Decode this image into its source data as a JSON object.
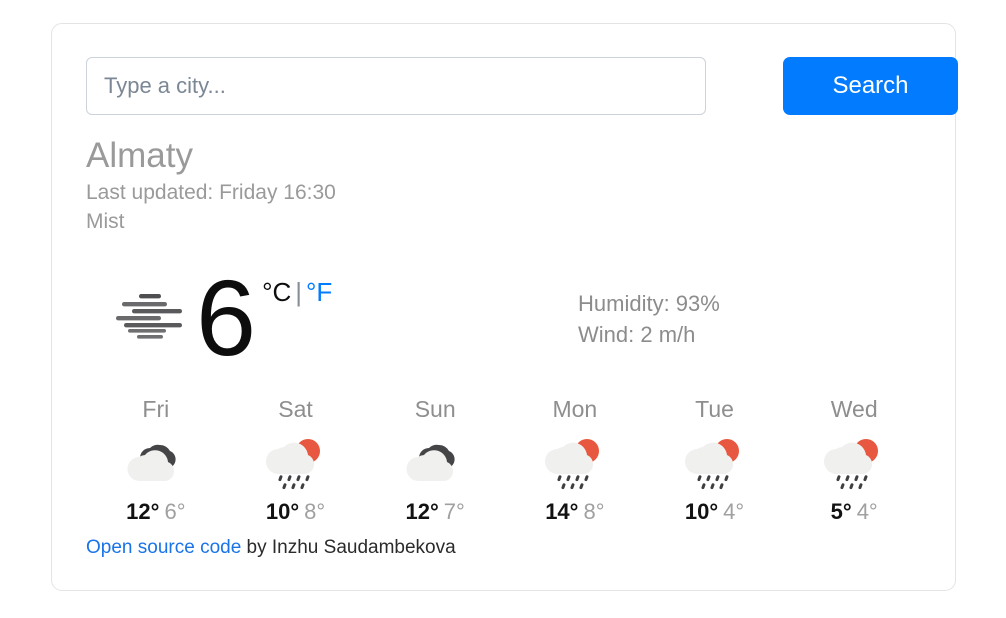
{
  "search": {
    "placeholder": "Type a city...",
    "value": "",
    "button_label": "Search"
  },
  "current": {
    "city": "Almaty",
    "last_updated": "Last updated: Friday 16:30",
    "condition": "Mist",
    "condition_icon": "mist-icon",
    "temperature": "6",
    "unit_celsius": "°C",
    "unit_separator": "|",
    "unit_fahrenheit": "°F",
    "humidity": "Humidity: 93%",
    "wind": "Wind: 2 m/h"
  },
  "forecast": [
    {
      "day": "Fri",
      "icon": "overcast-cloud-icon",
      "max": "12°",
      "min": "6°"
    },
    {
      "day": "Sat",
      "icon": "sun-rain-cloud-icon",
      "max": "10°",
      "min": "8°"
    },
    {
      "day": "Sun",
      "icon": "overcast-cloud-icon",
      "max": "12°",
      "min": "7°"
    },
    {
      "day": "Mon",
      "icon": "sun-rain-cloud-icon",
      "max": "14°",
      "min": "8°"
    },
    {
      "day": "Tue",
      "icon": "sun-rain-cloud-icon",
      "max": "10°",
      "min": "4°"
    },
    {
      "day": "Wed",
      "icon": "sun-rain-cloud-icon",
      "max": "5°",
      "min": "4°"
    }
  ],
  "footer": {
    "link_text": "Open source code",
    "credit_text": " by Inzhu Saudambekova"
  },
  "colors": {
    "accent_blue": "#027bff",
    "link_blue": "#1a73e8",
    "sun_orange": "#e8573f",
    "cloud_light": "#f0f0ef",
    "cloud_dark": "#454547",
    "muted_text": "#9a9a9a"
  }
}
